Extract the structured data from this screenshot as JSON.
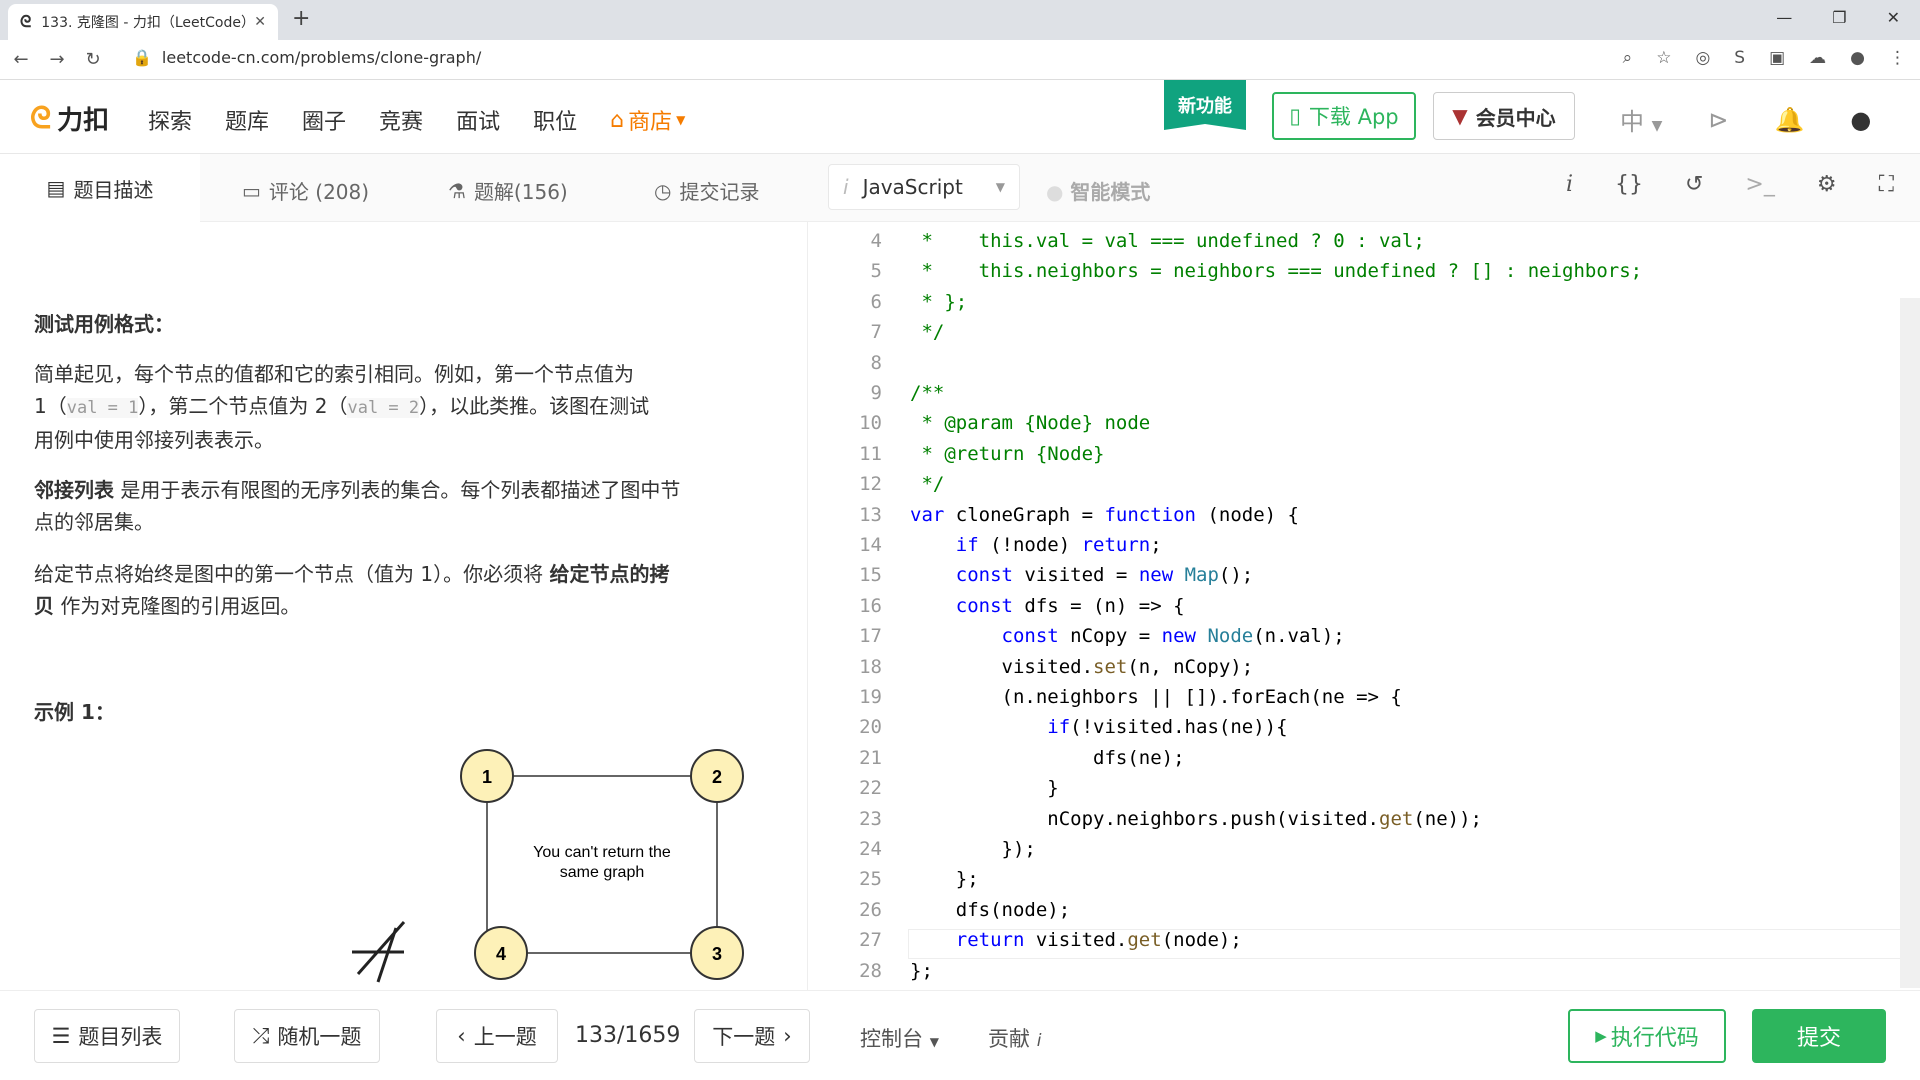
{
  "browser": {
    "tab_title": "133. 克隆图 - 力扣（LeetCode）",
    "url": "leetcode-cn.com/problems/clone-graph/"
  },
  "header": {
    "logo": "力扣",
    "nav": [
      "探索",
      "题库",
      "圈子",
      "竞赛",
      "面试",
      "职位"
    ],
    "shop": "商店",
    "new_feature": "新功能",
    "download_app": "下载 App",
    "vip": "会员中心",
    "lang_switch": "中"
  },
  "tabs": {
    "description": "题目描述",
    "comments": "评论 (208)",
    "solutions": "题解(156)",
    "submissions": "提交记录"
  },
  "editor_toolbar": {
    "language": "JavaScript",
    "smart_mode": "智能模式"
  },
  "description": {
    "test_format_heading": "测试用例格式：",
    "para1_a": "简单起见，每个节点的值都和它的索引相同。例如，第一个节点值为",
    "para1_b": "1（",
    "para1_code1": "val = 1",
    "para1_c": "），第二个节点值为 2（",
    "para1_code2": "val = 2",
    "para1_d": "），以此类推。该图在测试",
    "para1_e": "用例中使用邻接列表表示。",
    "para2_bold": "邻接列表",
    "para2_a": " 是用于表示有限图的无序列表的集合。每个列表都描述了图中节",
    "para2_b": "点的邻居集。",
    "para3_a": "给定节点将始终是图中的第一个节点（值为 1）。你必须将 ",
    "para3_bold1": "给定节点的拷",
    "para3_bold2": "贝",
    "para3_b": " 作为对克隆图的引用返回。",
    "example_heading": "示例 1：",
    "graph_nodes": [
      "1",
      "2",
      "3",
      "4"
    ],
    "graph_note_1": "You can't return the",
    "graph_note_2": "same graph"
  },
  "code_lines": [
    {
      "n": "4",
      "parts": [
        [
          "cm",
          " *    this.val = val === undefined ? 0 : val;"
        ]
      ]
    },
    {
      "n": "5",
      "parts": [
        [
          "cm",
          " *    this.neighbors = neighbors === undefined ? [] : neighbors;"
        ]
      ]
    },
    {
      "n": "6",
      "parts": [
        [
          "cm",
          " * };"
        ]
      ]
    },
    {
      "n": "7",
      "parts": [
        [
          "cm",
          " */"
        ]
      ]
    },
    {
      "n": "8",
      "parts": [
        [
          "tx",
          ""
        ]
      ]
    },
    {
      "n": "9",
      "parts": [
        [
          "cm",
          "/**"
        ]
      ]
    },
    {
      "n": "10",
      "parts": [
        [
          "cm",
          " * @param {Node} node"
        ]
      ]
    },
    {
      "n": "11",
      "parts": [
        [
          "cm",
          " * @return {Node}"
        ]
      ]
    },
    {
      "n": "12",
      "parts": [
        [
          "cm",
          " */"
        ]
      ]
    },
    {
      "n": "13",
      "parts": [
        [
          "kw",
          "var"
        ],
        [
          "tx",
          " cloneGraph = "
        ],
        [
          "kw",
          "function"
        ],
        [
          "tx",
          " (node) {"
        ]
      ]
    },
    {
      "n": "14",
      "parts": [
        [
          "tx",
          "    "
        ],
        [
          "kw",
          "if"
        ],
        [
          "tx",
          " (!node) "
        ],
        [
          "kw",
          "return"
        ],
        [
          "tx",
          ";"
        ]
      ]
    },
    {
      "n": "15",
      "parts": [
        [
          "tx",
          "    "
        ],
        [
          "kw",
          "const"
        ],
        [
          "tx",
          " visited = "
        ],
        [
          "kw",
          "new"
        ],
        [
          "tx",
          " "
        ],
        [
          "tp",
          "Map"
        ],
        [
          "tx",
          "();"
        ]
      ]
    },
    {
      "n": "16",
      "parts": [
        [
          "tx",
          "    "
        ],
        [
          "kw",
          "const"
        ],
        [
          "tx",
          " dfs = (n) => {"
        ]
      ]
    },
    {
      "n": "17",
      "parts": [
        [
          "tx",
          "        "
        ],
        [
          "kw",
          "const"
        ],
        [
          "tx",
          " nCopy = "
        ],
        [
          "kw",
          "new"
        ],
        [
          "tx",
          " "
        ],
        [
          "tp",
          "Node"
        ],
        [
          "tx",
          "(n.val);"
        ]
      ]
    },
    {
      "n": "18",
      "parts": [
        [
          "tx",
          "        visited."
        ],
        [
          "fn",
          "set"
        ],
        [
          "tx",
          "(n, nCopy);"
        ]
      ]
    },
    {
      "n": "19",
      "parts": [
        [
          "tx",
          "        (n.neighbors || []).forEach(ne => {"
        ]
      ]
    },
    {
      "n": "20",
      "parts": [
        [
          "tx",
          "            "
        ],
        [
          "kw",
          "if"
        ],
        [
          "tx",
          "(!visited.has(ne)){"
        ]
      ]
    },
    {
      "n": "21",
      "parts": [
        [
          "tx",
          "                dfs(ne);"
        ]
      ]
    },
    {
      "n": "22",
      "parts": [
        [
          "tx",
          "            }"
        ]
      ]
    },
    {
      "n": "23",
      "parts": [
        [
          "tx",
          "            nCopy.neighbors.push(visited."
        ],
        [
          "fn",
          "get"
        ],
        [
          "tx",
          "(ne));"
        ]
      ]
    },
    {
      "n": "24",
      "parts": [
        [
          "tx",
          "        });"
        ]
      ]
    },
    {
      "n": "25",
      "parts": [
        [
          "tx",
          "    };"
        ]
      ]
    },
    {
      "n": "26",
      "parts": [
        [
          "tx",
          "    dfs(node);"
        ]
      ]
    },
    {
      "n": "27",
      "parts": [
        [
          "tx",
          "    "
        ],
        [
          "kw",
          "return"
        ],
        [
          "tx",
          " visited."
        ],
        [
          "fn",
          "get"
        ],
        [
          "tx",
          "(node);"
        ]
      ]
    },
    {
      "n": "28",
      "parts": [
        [
          "tx",
          "};"
        ]
      ]
    }
  ],
  "bottom": {
    "problem_list": "题目列表",
    "random": "随机一题",
    "prev": "上一题",
    "page": "133/1659",
    "next": "下一题",
    "console": "控制台",
    "contribute": "贡献",
    "run": "执行代码",
    "submit": "提交"
  }
}
